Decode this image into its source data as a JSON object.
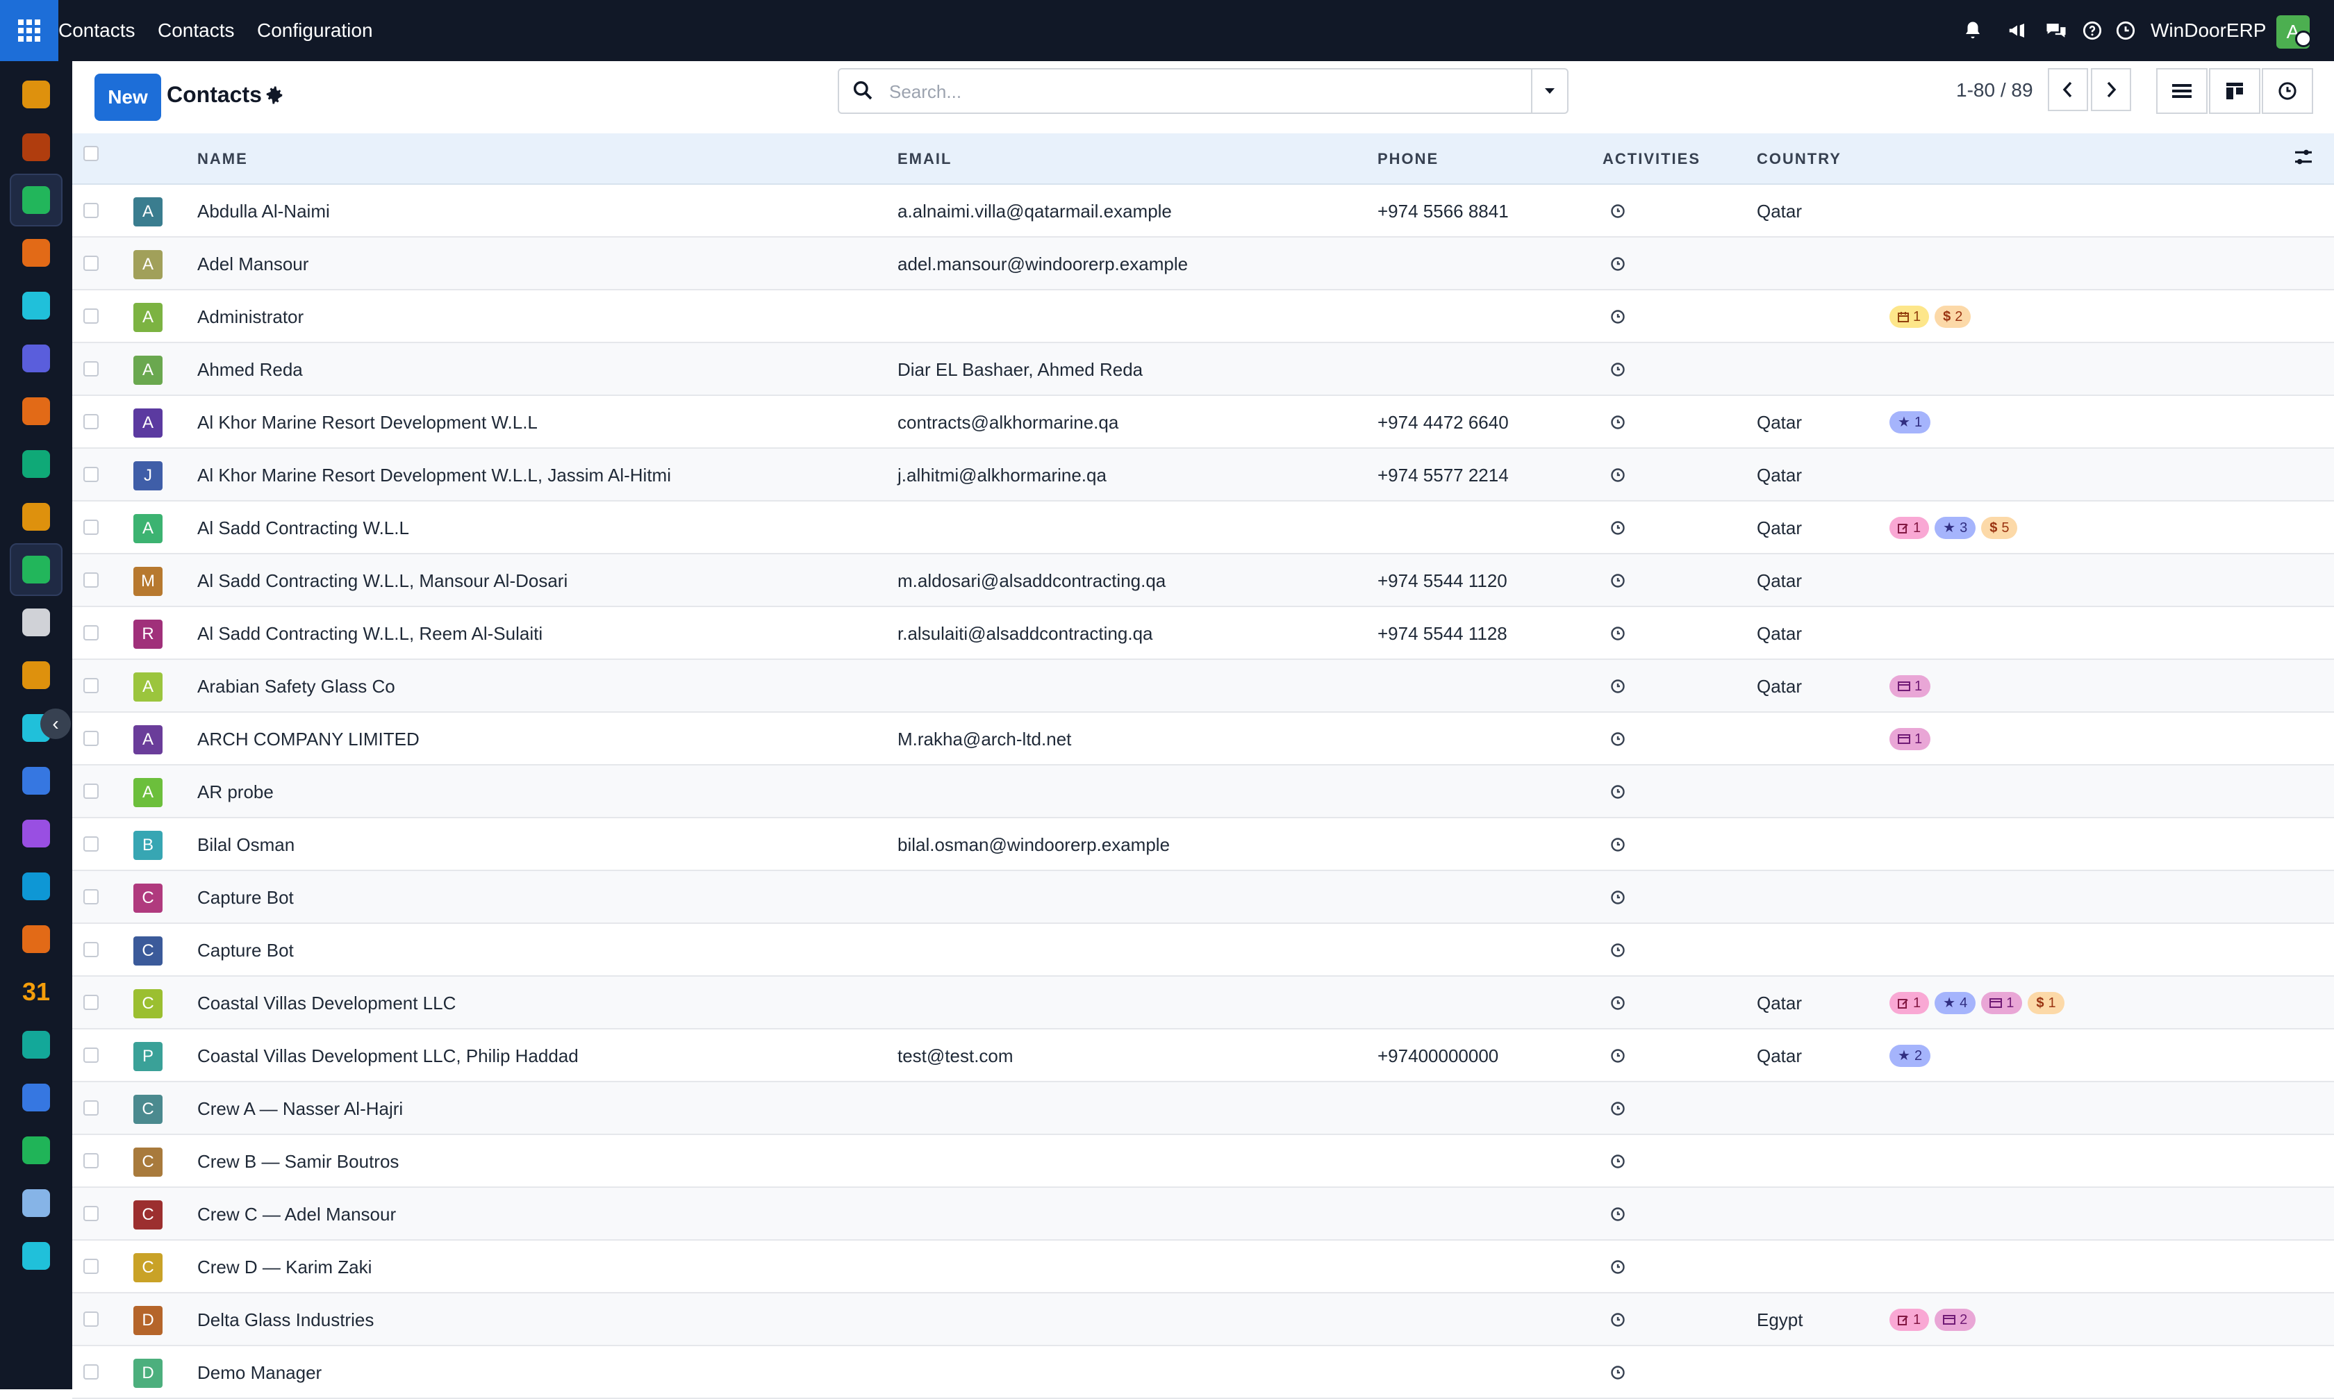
{
  "topbar": {
    "menu": [
      "Contacts",
      "Contacts",
      "Configuration"
    ],
    "icons": [
      "bell-icon",
      "megaphone-icon",
      "chat-icon",
      "help-icon",
      "clock-icon"
    ],
    "brand": "WinDoorERP",
    "user_initial": "A"
  },
  "sidebar": {
    "apps": [
      {
        "icon": "dashboard-app-icon",
        "color": "#f59e0b"
      },
      {
        "icon": "photos-app-icon",
        "color": "#c2410c"
      },
      {
        "icon": "contacts-app-icon",
        "color": "#22c55e",
        "active": true
      },
      {
        "icon": "chat-bubble-app-icon",
        "color": "#f97316"
      },
      {
        "icon": "discuss-app-icon",
        "color": "#22d3ee"
      },
      {
        "icon": "mail-app-icon",
        "color": "#6366f1"
      },
      {
        "icon": "helpdesk-app-icon",
        "color": "#f97316"
      },
      {
        "icon": "paper-plane-app-icon",
        "color": "#10b981"
      },
      {
        "icon": "reports-app-icon",
        "color": "#f59e0b"
      },
      {
        "icon": "address-book-app-icon",
        "color": "#22c55e",
        "active": true
      },
      {
        "icon": "cube-app-icon",
        "color": "#e5e7eb"
      },
      {
        "icon": "sales-app-icon",
        "color": "#f59e0b"
      },
      {
        "icon": "tasks-app-icon",
        "color": "#22d3ee"
      },
      {
        "icon": "knowledge-app-icon",
        "color": "#3b82f6"
      },
      {
        "icon": "inventory-app-icon",
        "color": "#a855f7"
      },
      {
        "icon": "invoicing-app-icon",
        "color": "#0ea5e9"
      },
      {
        "icon": "employees-app-icon",
        "color": "#f97316"
      },
      {
        "icon": "calendar-app-icon",
        "color": "#f59e0b"
      },
      {
        "icon": "sign-app-icon",
        "color": "#14b8a6"
      },
      {
        "icon": "widgets-app-icon",
        "color": "#3b82f6"
      },
      {
        "icon": "whatsapp-app-icon",
        "color": "#22c55e"
      },
      {
        "icon": "timer-app-icon",
        "color": "#93c5fd"
      },
      {
        "icon": "wave-app-icon",
        "color": "#22d3ee"
      }
    ],
    "calendar_number": "31"
  },
  "control": {
    "new_label": "New",
    "title": "Contacts",
    "search_placeholder": "Search...",
    "pager": "1-80 / 89"
  },
  "table": {
    "headers": {
      "name": "NAME",
      "email": "EMAIL",
      "phone": "PHONE",
      "activities": "ACTIVITIES",
      "country": "COUNTRY"
    },
    "rows": [
      {
        "initial": "A",
        "avatar": "#3a7d8f",
        "name": "Abdulla Al-Naimi",
        "email": "a.alnaimi.villa@qatarmail.example",
        "phone": "+974 5566 8841",
        "country": "Qatar",
        "badges": []
      },
      {
        "initial": "A",
        "avatar": "#a1a05a",
        "name": "Adel Mansour",
        "email": "adel.mansour@windoorerp.example",
        "phone": "",
        "country": "",
        "badges": []
      },
      {
        "initial": "A",
        "avatar": "#7cb342",
        "name": "Administrator",
        "email": "",
        "phone": "",
        "country": "",
        "badges": [
          {
            "icon": "calendar-icon",
            "count": "1",
            "bg": "#fde68a",
            "fg": "#92400e"
          },
          {
            "icon": "dollar-icon",
            "count": "2",
            "bg": "#fcd9a8",
            "fg": "#9a3412"
          }
        ]
      },
      {
        "initial": "A",
        "avatar": "#6aa84f",
        "name": "Ahmed Reda",
        "email": "Diar EL Bashaer, Ahmed Reda",
        "phone": "",
        "country": "",
        "badges": []
      },
      {
        "initial": "A",
        "avatar": "#5b3aa0",
        "name": "Al Khor Marine Resort Development W.L.L",
        "email": "contracts@alkhormarine.qa",
        "phone": "+974 4472 6640",
        "country": "Qatar",
        "badges": [
          {
            "icon": "star-icon",
            "count": "1",
            "bg": "#a5b4fc",
            "fg": "#312e81"
          }
        ]
      },
      {
        "initial": "J",
        "avatar": "#3f5ea8",
        "name": "Al Khor Marine Resort Development W.L.L, Jassim Al-Hitmi",
        "email": "j.alhitmi@alkhormarine.qa",
        "phone": "+974 5577 2214",
        "country": "Qatar",
        "badges": []
      },
      {
        "initial": "A",
        "avatar": "#3cb371",
        "name": "Al Sadd Contracting W.L.L",
        "email": "",
        "phone": "",
        "country": "Qatar",
        "badges": [
          {
            "icon": "edit-icon",
            "count": "1",
            "bg": "#f9a8d4",
            "fg": "#831843"
          },
          {
            "icon": "star-icon",
            "count": "3",
            "bg": "#a5b4fc",
            "fg": "#312e81"
          },
          {
            "icon": "dollar-icon",
            "count": "5",
            "bg": "#fcd9a8",
            "fg": "#9a3412"
          }
        ]
      },
      {
        "initial": "M",
        "avatar": "#b7792f",
        "name": "Al Sadd Contracting W.L.L, Mansour Al-Dosari",
        "email": "m.aldosari@alsaddcontracting.qa",
        "phone": "+974 5544 1120",
        "country": "Qatar",
        "badges": []
      },
      {
        "initial": "R",
        "avatar": "#a0307a",
        "name": "Al Sadd Contracting W.L.L, Reem Al-Sulaiti",
        "email": "r.alsulaiti@alsaddcontracting.qa",
        "phone": "+974 5544 1128",
        "country": "Qatar",
        "badges": []
      },
      {
        "initial": "A",
        "avatar": "#9bc53d",
        "name": "Arabian Safety Glass Co",
        "email": "",
        "phone": "",
        "country": "Qatar",
        "badges": [
          {
            "icon": "card-icon",
            "count": "1",
            "bg": "#e9a6d6",
            "fg": "#701a75"
          }
        ]
      },
      {
        "initial": "A",
        "avatar": "#6a3d9a",
        "name": "ARCH COMPANY LIMITED",
        "email": "M.rakha@arch-ltd.net",
        "phone": "",
        "country": "",
        "badges": [
          {
            "icon": "card-icon",
            "count": "1",
            "bg": "#e9a6d6",
            "fg": "#701a75"
          }
        ]
      },
      {
        "initial": "A",
        "avatar": "#6cbf3c",
        "name": "AR probe",
        "email": "",
        "phone": "",
        "country": "",
        "badges": []
      },
      {
        "initial": "B",
        "avatar": "#37a6b3",
        "name": "Bilal Osman",
        "email": "bilal.osman@windoorerp.example",
        "phone": "",
        "country": "",
        "badges": []
      },
      {
        "initial": "C",
        "avatar": "#b03a7e",
        "name": "Capture Bot",
        "email": "",
        "phone": "",
        "country": "",
        "badges": []
      },
      {
        "initial": "C",
        "avatar": "#3b5a9a",
        "name": "Capture Bot",
        "email": "",
        "phone": "",
        "country": "",
        "badges": []
      },
      {
        "initial": "C",
        "avatar": "#9bbf30",
        "name": "Coastal Villas Development LLC",
        "email": "",
        "phone": "",
        "country": "Qatar",
        "badges": [
          {
            "icon": "edit-icon",
            "count": "1",
            "bg": "#f9a8d4",
            "fg": "#831843"
          },
          {
            "icon": "star-icon",
            "count": "4",
            "bg": "#a5b4fc",
            "fg": "#312e81"
          },
          {
            "icon": "card-icon",
            "count": "1",
            "bg": "#e9a6d6",
            "fg": "#701a75"
          },
          {
            "icon": "dollar-icon",
            "count": "1",
            "bg": "#fcd9a8",
            "fg": "#9a3412"
          }
        ]
      },
      {
        "initial": "P",
        "avatar": "#3aa198",
        "name": "Coastal Villas Development LLC, Philip Haddad",
        "email": "test@test.com",
        "phone": "+97400000000",
        "country": "Qatar",
        "badges": [
          {
            "icon": "star-icon",
            "count": "2",
            "bg": "#a5b4fc",
            "fg": "#312e81"
          }
        ]
      },
      {
        "initial": "C",
        "avatar": "#4b8a8f",
        "name": "Crew A — Nasser Al-Hajri",
        "email": "",
        "phone": "",
        "country": "",
        "badges": []
      },
      {
        "initial": "C",
        "avatar": "#a87a3c",
        "name": "Crew B — Samir Boutros",
        "email": "",
        "phone": "",
        "country": "",
        "badges": []
      },
      {
        "initial": "C",
        "avatar": "#9c2f2f",
        "name": "Crew C — Adel Mansour",
        "email": "",
        "phone": "",
        "country": "",
        "badges": []
      },
      {
        "initial": "C",
        "avatar": "#c9a227",
        "name": "Crew D — Karim Zaki",
        "email": "",
        "phone": "",
        "country": "",
        "badges": []
      },
      {
        "initial": "D",
        "avatar": "#b5652a",
        "name": "Delta Glass Industries",
        "email": "",
        "phone": "",
        "country": "Egypt",
        "badges": [
          {
            "icon": "edit-icon",
            "count": "1",
            "bg": "#f9a8d4",
            "fg": "#831843"
          },
          {
            "icon": "card-icon",
            "count": "2",
            "bg": "#e9a6d6",
            "fg": "#701a75"
          }
        ]
      },
      {
        "initial": "D",
        "avatar": "#4caf7d",
        "name": "Demo Manager",
        "email": "",
        "phone": "",
        "country": "",
        "badges": []
      }
    ]
  }
}
